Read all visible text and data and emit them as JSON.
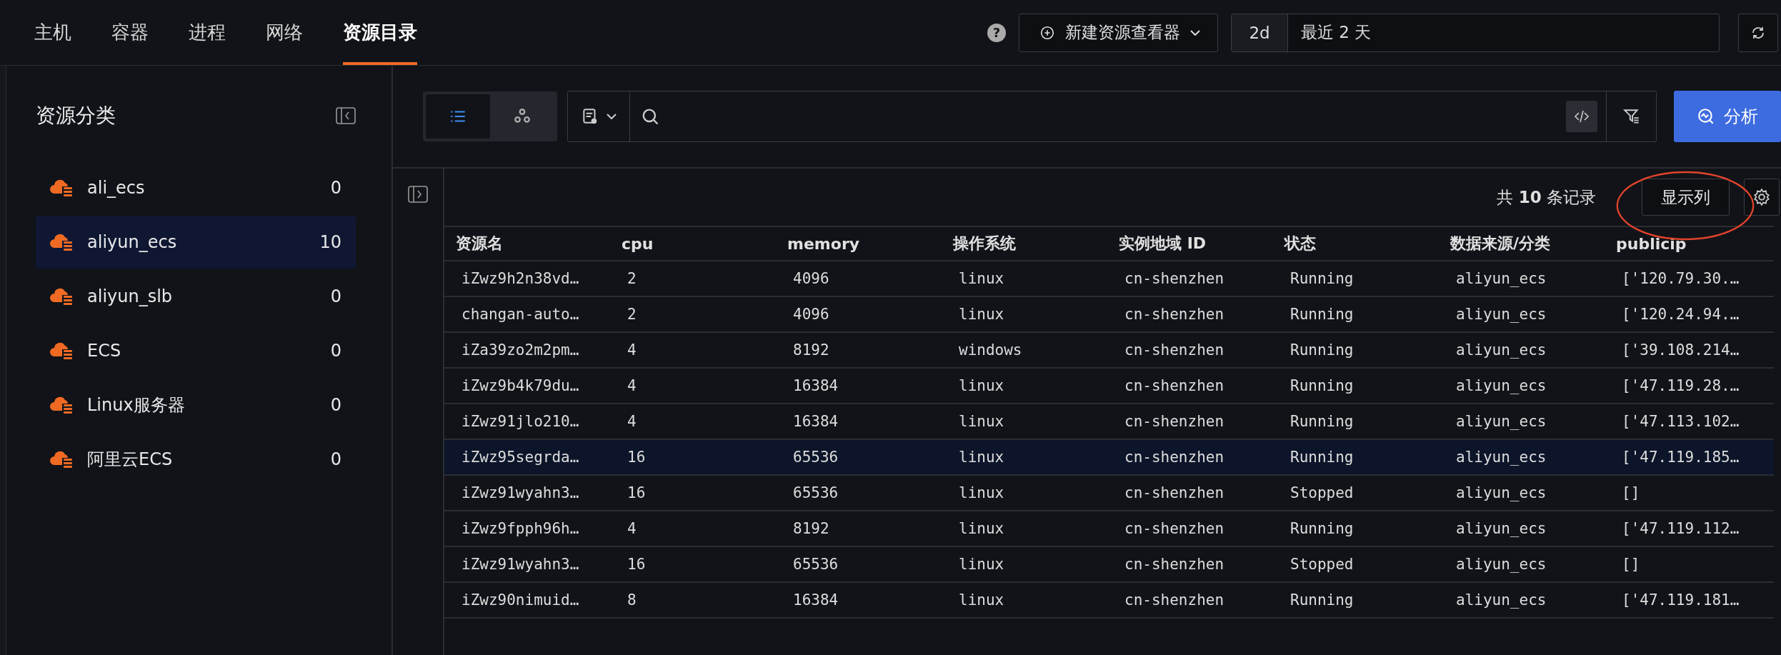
{
  "top_tabs": [
    {
      "label": "主机",
      "selected": false
    },
    {
      "label": "容器",
      "selected": false
    },
    {
      "label": "进程",
      "selected": false
    },
    {
      "label": "网络",
      "selected": false
    },
    {
      "label": "资源目录",
      "selected": true
    }
  ],
  "help_icon": "?",
  "new_viewer_button": {
    "label": "新建资源查看器"
  },
  "time_range": {
    "shortcut": "2d",
    "label": "最近 2 天"
  },
  "sidebar": {
    "title": "资源分类",
    "items": [
      {
        "name": "ali_ecs",
        "count": "0",
        "selected": false
      },
      {
        "name": "aliyun_ecs",
        "count": "10",
        "selected": true
      },
      {
        "name": "aliyun_slb",
        "count": "0",
        "selected": false
      },
      {
        "name": "ECS",
        "count": "0",
        "selected": false
      },
      {
        "name": "Linux服务器",
        "count": "0",
        "selected": false
      },
      {
        "name": "阿里云ECS",
        "count": "0",
        "selected": false
      }
    ]
  },
  "view_toggle": [
    {
      "kind": "list",
      "selected": true
    },
    {
      "kind": "graph",
      "selected": false
    }
  ],
  "analyze_button": {
    "label": "分析"
  },
  "record_count": "共 **10** 条记录",
  "columns_button": {
    "label": "显示列"
  },
  "table": {
    "columns": [
      "资源名",
      "cpu",
      "memory",
      "操作系统",
      "实例地域 ID",
      "状态",
      "数据来源/分类",
      "publicip"
    ],
    "rows": [
      {
        "selected": false,
        "cells": [
          "iZwz9h2n38vd…",
          "2",
          "4096",
          "linux",
          "cn-shenzhen",
          "Running",
          "aliyun_ecs",
          "['120.79.30.…"
        ]
      },
      {
        "selected": false,
        "cells": [
          "changan-auto…",
          "2",
          "4096",
          "linux",
          "cn-shenzhen",
          "Running",
          "aliyun_ecs",
          "['120.24.94.…"
        ]
      },
      {
        "selected": false,
        "cells": [
          "iZa39zo2m2pm…",
          "4",
          "8192",
          "windows",
          "cn-shenzhen",
          "Running",
          "aliyun_ecs",
          "['39.108.214…"
        ]
      },
      {
        "selected": false,
        "cells": [
          "iZwz9b4k79du…",
          "4",
          "16384",
          "linux",
          "cn-shenzhen",
          "Running",
          "aliyun_ecs",
          "['47.119.28.…"
        ]
      },
      {
        "selected": false,
        "cells": [
          "iZwz91jlo210…",
          "4",
          "16384",
          "linux",
          "cn-shenzhen",
          "Running",
          "aliyun_ecs",
          "['47.113.102…"
        ]
      },
      {
        "selected": true,
        "cells": [
          "iZwz95segrda…",
          "16",
          "65536",
          "linux",
          "cn-shenzhen",
          "Running",
          "aliyun_ecs",
          "['47.119.185…"
        ]
      },
      {
        "selected": false,
        "cells": [
          "iZwz91wyahn3…",
          "16",
          "65536",
          "linux",
          "cn-shenzhen",
          "Stopped",
          "aliyun_ecs",
          "[]"
        ]
      },
      {
        "selected": false,
        "cells": [
          "iZwz9fpph96h…",
          "4",
          "8192",
          "linux",
          "cn-shenzhen",
          "Running",
          "aliyun_ecs",
          "['47.119.112…"
        ]
      },
      {
        "selected": false,
        "cells": [
          "iZwz91wyahn3…",
          "16",
          "65536",
          "linux",
          "cn-shenzhen",
          "Stopped",
          "aliyun_ecs",
          "[]"
        ]
      },
      {
        "selected": false,
        "cells": [
          "iZwz90nimuid…",
          "8",
          "16384",
          "linux",
          "cn-shenzhen",
          "Running",
          "aliyun_ecs",
          "['47.119.181…"
        ]
      }
    ]
  }
}
